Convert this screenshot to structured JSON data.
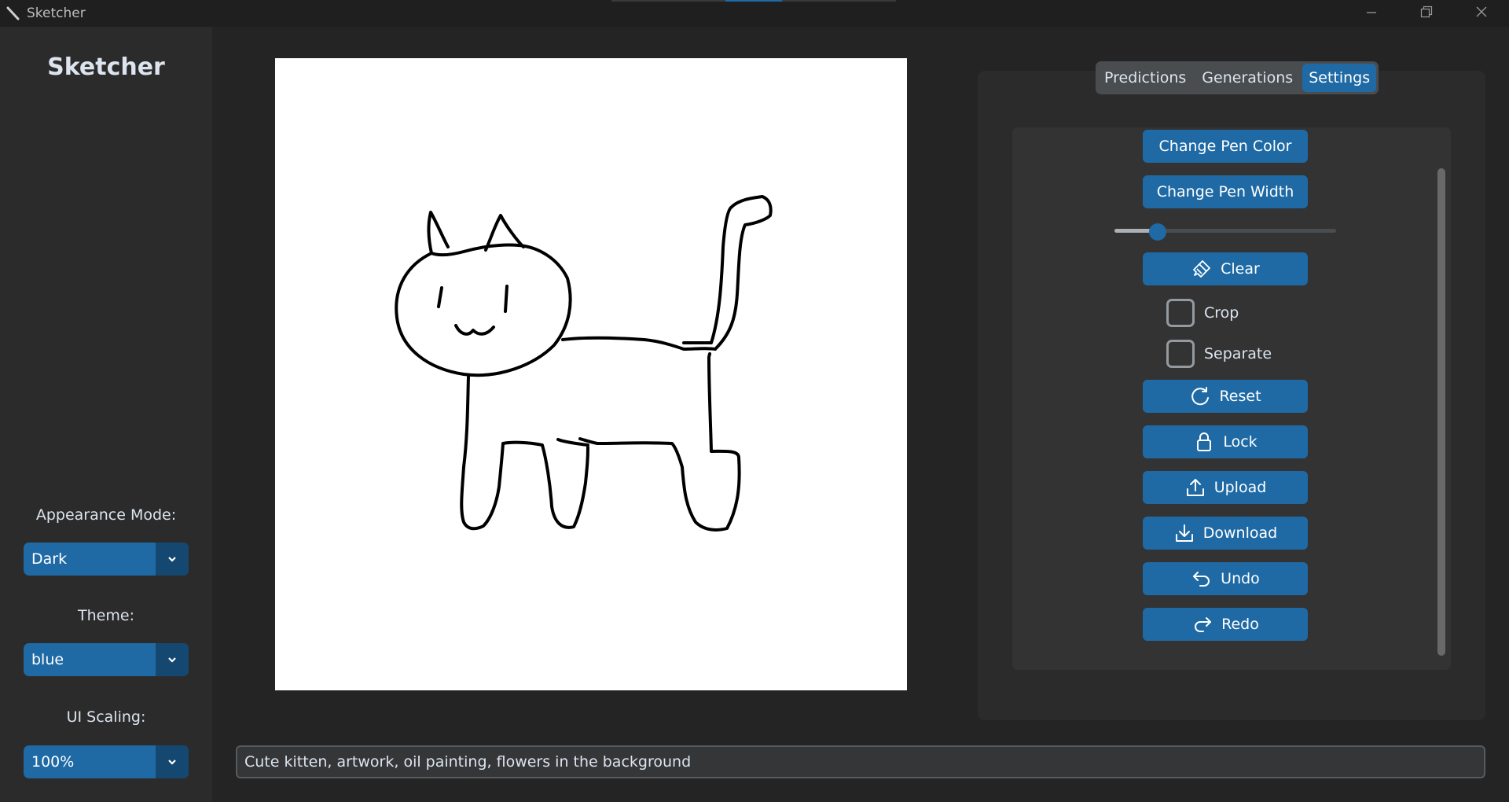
{
  "window": {
    "title": "Sketcher",
    "icons": {
      "app": "pen-icon",
      "minimize": "minimize-icon",
      "maximize": "restore-icon",
      "close": "close-icon"
    }
  },
  "sidebar": {
    "logo": "Sketcher",
    "appearance_label": "Appearance Mode:",
    "appearance_value": "Dark",
    "theme_label": "Theme:",
    "theme_value": "blue",
    "scaling_label": "UI Scaling:",
    "scaling_value": "100%"
  },
  "tabs": [
    {
      "label": "Predictions",
      "active": false
    },
    {
      "label": "Generations",
      "active": false
    },
    {
      "label": "Settings",
      "active": true
    }
  ],
  "settings": {
    "pen_color_label": "Change Pen Color",
    "pen_width_label": "Change Pen Width",
    "pen_width_slider_value": 0.17,
    "clear_label": "Clear",
    "crop_label": "Crop",
    "crop_checked": false,
    "separate_label": "Separate",
    "separate_checked": false,
    "reset_label": "Reset",
    "lock_label": "Lock",
    "upload_label": "Upload",
    "download_label": "Download",
    "undo_label": "Undo",
    "redo_label": "Redo"
  },
  "prompt": {
    "value": "Cute kitten, artwork, oil painting, flowers in the background"
  },
  "colors": {
    "accent": "#1f6aa5",
    "accent_dark": "#144870",
    "background": "#242424",
    "panel": "#2b2b2b",
    "canvas": "#ffffff",
    "ink": "#000000"
  }
}
